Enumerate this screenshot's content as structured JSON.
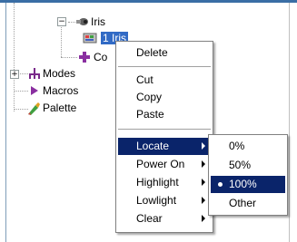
{
  "tree": {
    "nodes": [
      {
        "label": "Iris",
        "expander": "−"
      },
      {
        "label": "1 Iris",
        "selected": true
      },
      {
        "label": "Co"
      },
      {
        "label": "Modes",
        "expander": "+"
      },
      {
        "label": "Macros"
      },
      {
        "label": "Palette"
      }
    ]
  },
  "context_menu": {
    "items": [
      {
        "label": "Delete"
      },
      {
        "label": "Cut"
      },
      {
        "label": "Copy"
      },
      {
        "label": "Paste"
      },
      {
        "label": "Locate",
        "submenu": true,
        "active": true
      },
      {
        "label": "Power On",
        "submenu": true
      },
      {
        "label": "Highlight",
        "submenu": true
      },
      {
        "label": "Lowlight",
        "submenu": true
      },
      {
        "label": "Clear",
        "submenu": true
      }
    ]
  },
  "locate_submenu": {
    "items": [
      {
        "label": "0%"
      },
      {
        "label": "50%"
      },
      {
        "label": "100%",
        "checked": true,
        "active": true
      },
      {
        "label": "Other"
      }
    ]
  },
  "colors": {
    "menu_highlight": "#0a246a",
    "selection": "#316ac5",
    "title_bar": "#3a6ea5"
  }
}
